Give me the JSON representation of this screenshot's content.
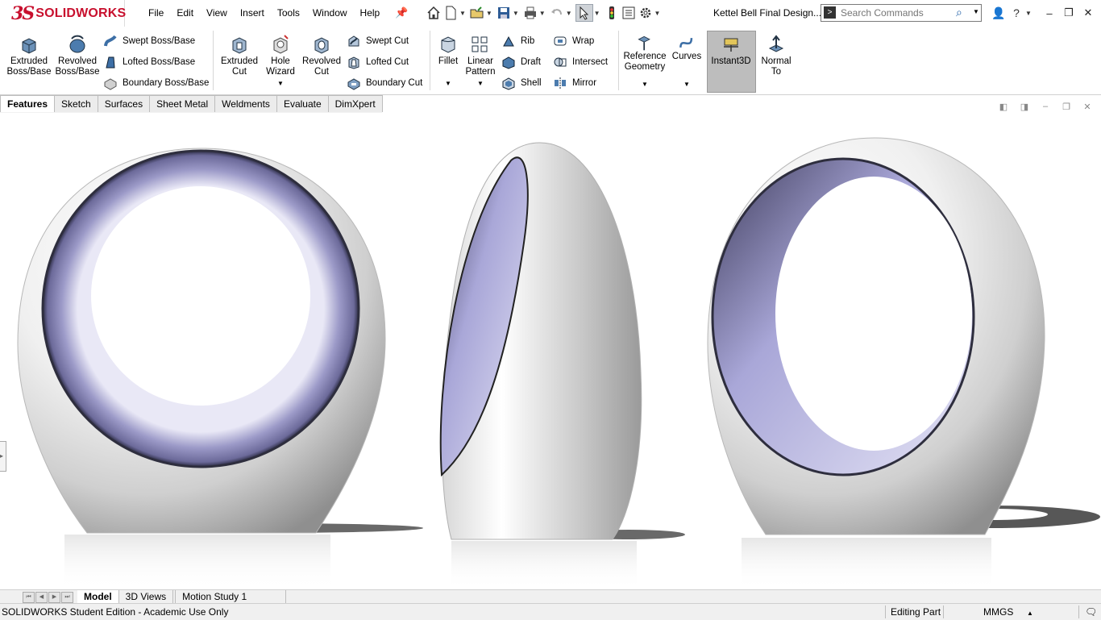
{
  "app": {
    "logo_mark": "3S",
    "logo_text": "SOLIDWORKS",
    "document_title": "Kettel Bell Final Design..."
  },
  "menu": [
    "File",
    "Edit",
    "View",
    "Insert",
    "Tools",
    "Window",
    "Help"
  ],
  "search": {
    "placeholder": "Search Commands"
  },
  "ribbon": {
    "extruded_boss": [
      "Extruded",
      "Boss/Base"
    ],
    "revolved_boss": [
      "Revolved",
      "Boss/Base"
    ],
    "swept_boss": "Swept Boss/Base",
    "lofted_boss": "Lofted Boss/Base",
    "boundary_boss": "Boundary Boss/Base",
    "extruded_cut": [
      "Extruded",
      "Cut"
    ],
    "hole_wizard": [
      "Hole",
      "Wizard"
    ],
    "revolved_cut": [
      "Revolved",
      "Cut"
    ],
    "swept_cut": "Swept Cut",
    "lofted_cut": "Lofted Cut",
    "boundary_cut": "Boundary Cut",
    "fillet": "Fillet",
    "linear_pattern": [
      "Linear",
      "Pattern"
    ],
    "rib": "Rib",
    "draft": "Draft",
    "shell": "Shell",
    "wrap": "Wrap",
    "intersect": "Intersect",
    "mirror": "Mirror",
    "reference_geometry": [
      "Reference",
      "Geometry"
    ],
    "curves": "Curves",
    "instant3d": "Instant3D",
    "normal_to": [
      "Normal",
      "To"
    ]
  },
  "tabs": [
    "Features",
    "Sketch",
    "Surfaces",
    "Sheet Metal",
    "Weldments",
    "Evaluate",
    "DimXpert"
  ],
  "active_tab": "Features",
  "bottom_tabs": [
    "Model",
    "3D Views",
    "Motion Study 1"
  ],
  "status": {
    "left": "SOLIDWORKS Student Edition - Academic Use Only",
    "mode": "Editing Part",
    "units": "MMGS"
  },
  "colors": {
    "brand": "#c8102e",
    "accent": "#1f6fbf",
    "toggle_active": "#bdbdbd"
  }
}
